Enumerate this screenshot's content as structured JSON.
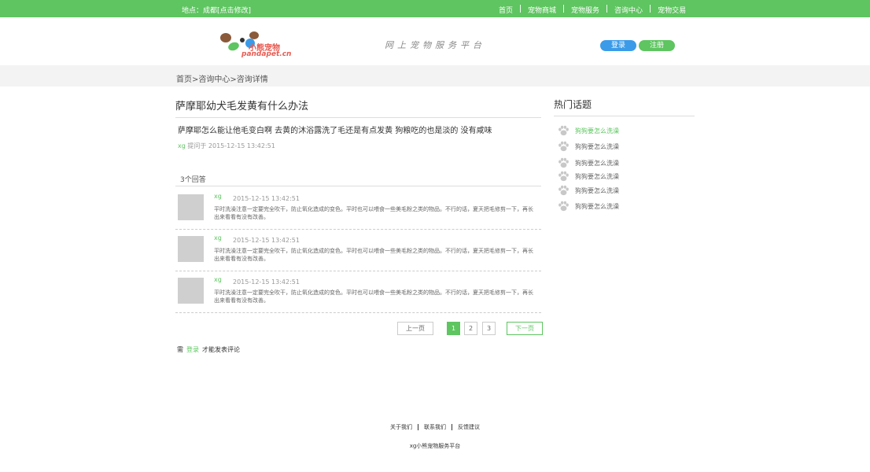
{
  "topbar": {
    "location": "地点：成都[点击修改]",
    "nav": [
      "首页",
      "宠物商城",
      "宠物服务",
      "咨询中心",
      "宠物交易"
    ]
  },
  "header": {
    "logo_brand": "小熊宠物",
    "logo_domain": "pandapet.cn",
    "slogan": "网上宠物服务平台",
    "login_label": "登录",
    "register_label": "注册"
  },
  "breadcrumb": "首页>咨询中心>咨询详情",
  "question": {
    "title": "萨摩耶幼犬毛发黄有什么办法",
    "body": "萨摩耶怎么能让他毛变白啊 去黄的沐浴露洗了毛还是有点发黄 狗粮吃的也是淡的 没有咸味",
    "user": "xg",
    "meta": "提问于 2015-12-15 13:42:51"
  },
  "answers_count": "3个回答",
  "answers": [
    {
      "user": "xg",
      "time": "2015-12-15 13:42:51",
      "text": "平时洗澡注意一定要完全吹干，防止氧化造成的变色。平时也可以喂食一些美毛粉之类的物品。不行的话，夏天把毛修剪一下，再长出来看看有没有改善。"
    },
    {
      "user": "xg",
      "time": "2015-12-15 13:42:51",
      "text": "平时洗澡注意一定要完全吹干，防止氧化造成的变色。平时也可以喂食一些美毛粉之类的物品。不行的话，夏天把毛修剪一下，再长出来看看有没有改善。"
    },
    {
      "user": "xg",
      "time": "2015-12-15 13:42:51",
      "text": "平时洗澡注意一定要完全吹干，防止氧化造成的变色。平时也可以喂食一些美毛粉之类的物品。不行的话，夏天把毛修剪一下，再长出来看看有没有改善。"
    }
  ],
  "pager": {
    "prev": "上一页",
    "pages": [
      "1",
      "2",
      "3"
    ],
    "current": "1",
    "next": "下一页"
  },
  "comment_note": {
    "before": "需",
    "login_link": "登录",
    "after": "才能发表评论"
  },
  "sidebar": {
    "title": "热门话题",
    "topics": [
      "狗狗要怎么洗澡",
      "狗狗要怎么洗澡",
      "狗狗要怎么洗澡",
      "狗狗要怎么洗澡",
      "狗狗要怎么洗澡",
      "狗狗要怎么洗澡"
    ]
  },
  "footer": {
    "links": [
      "关于我们",
      "联系我们",
      "反馈建议"
    ],
    "copyright": "xg小熊宠物服务平台"
  },
  "colors": {
    "accent_green": "#5ec560",
    "login_blue": "#3b9be8",
    "logo_red": "#e85b52"
  }
}
